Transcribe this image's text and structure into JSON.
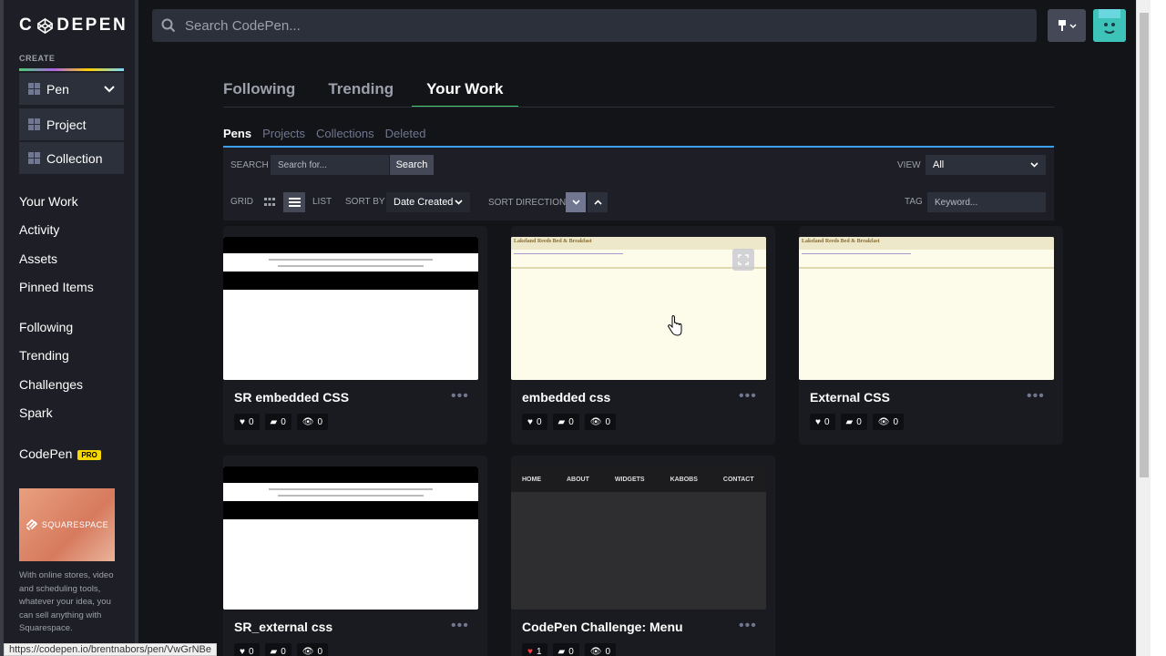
{
  "brand": {
    "logo_text": "CODEPEN"
  },
  "sidebar": {
    "create_label": "CREATE",
    "create_items": [
      {
        "label": "Pen"
      },
      {
        "label": "Project"
      },
      {
        "label": "Collection"
      }
    ],
    "nav_primary": [
      "Your Work",
      "Activity",
      "Assets",
      "Pinned Items"
    ],
    "nav_secondary": [
      "Following",
      "Trending",
      "Challenges",
      "Spark"
    ],
    "codepen_label": "CodePen",
    "pro_badge": "PRO",
    "ad": {
      "brand": "SQUARESPACE",
      "text": "With online stores, video and scheduling tools, whatever your idea, you can sell anything with Squarespace."
    }
  },
  "topbar": {
    "search_placeholder": "Search CodePen..."
  },
  "main_tabs": [
    {
      "label": "Following",
      "active": false
    },
    {
      "label": "Trending",
      "active": false
    },
    {
      "label": "Your Work",
      "active": true
    }
  ],
  "sub_tabs": [
    {
      "label": "Pens",
      "active": true
    },
    {
      "label": "Projects",
      "active": false
    },
    {
      "label": "Collections",
      "active": false
    },
    {
      "label": "Deleted",
      "active": false
    }
  ],
  "filters": {
    "search_label": "SEARCH",
    "search_placeholder": "Search for...",
    "search_button": "Search",
    "view_label": "VIEW",
    "view_value": "All",
    "grid_label": "GRID",
    "list_label": "LIST",
    "sort_by_label": "SORT BY",
    "sort_by_value": "Date Created",
    "sort_direction_label": "SORT DIRECTION",
    "tag_label": "TAG",
    "tag_placeholder": "Keyword..."
  },
  "cards": [
    {
      "title": "SR embedded CSS",
      "likes": "0",
      "comments": "0",
      "views": "0"
    },
    {
      "title": "embedded css",
      "likes": "0",
      "comments": "0",
      "views": "0"
    },
    {
      "title": "External CSS",
      "likes": "0",
      "comments": "0",
      "views": "0"
    },
    {
      "title": "SR_external css",
      "likes": "0",
      "comments": "0",
      "views": "0"
    },
    {
      "title": "CodePen Challenge: Menu",
      "likes": "1",
      "comments": "0",
      "views": "0"
    }
  ],
  "thumb_text": {
    "bnb_heading": "Lakeland Reeds Bed & Breakfast",
    "menu_items": [
      "HOME",
      "ABOUT",
      "WIDGETS",
      "KABOBS",
      "CONTACT"
    ]
  },
  "status_bar": {
    "url": "https://codepen.io/brentnabors/pen/VwGrNBe"
  },
  "colors": {
    "accent_green": "#47cf73",
    "accent_blue": "#3a9ef1",
    "pro_yellow": "#f7d800",
    "like_pink": "#ff3c41"
  }
}
